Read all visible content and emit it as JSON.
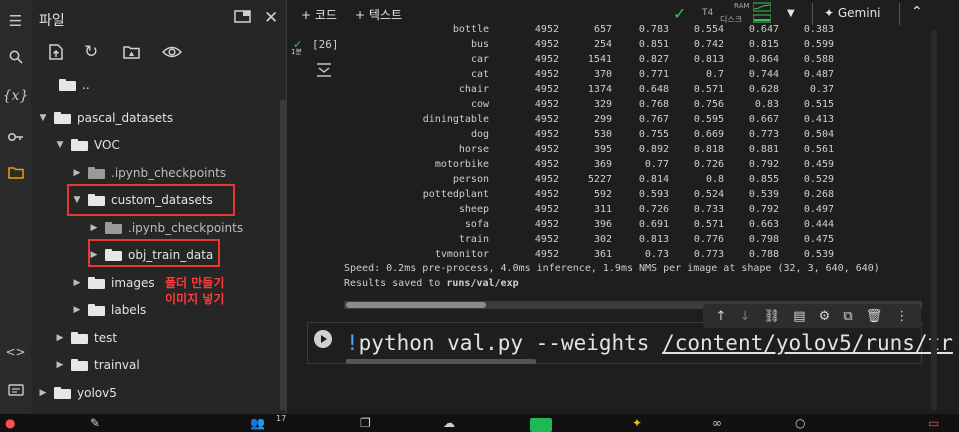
{
  "colors": {
    "accent_red": "#e53935",
    "annotation": "#ff3b3b",
    "run_blue": "#4ea1ff",
    "check_green": "#3ac25a",
    "folder_icon": "orange"
  },
  "rail": {
    "icons": [
      "menu-icon",
      "search-icon",
      "variables-icon",
      "key-icon",
      "folder-icon",
      "code-icon",
      "terminal-icon"
    ],
    "var_label": "{x}"
  },
  "files": {
    "title": "파일",
    "parent_label": "..",
    "tree": [
      {
        "label": "pascal_datasets"
      },
      {
        "label": "VOC"
      },
      {
        "label": ".ipynb_checkpoints"
      },
      {
        "label": "custom_datasets"
      },
      {
        "label": ".ipynb_checkpoints"
      },
      {
        "label": "obj_train_data"
      },
      {
        "label": "images"
      },
      {
        "label": "labels"
      },
      {
        "label": "test"
      },
      {
        "label": "trainval"
      },
      {
        "label": "yolov5"
      }
    ],
    "annotation_line1": "폴더 만들기",
    "annotation_line2": "이미지 넣기"
  },
  "topbar": {
    "add_code": "+ 코드",
    "add_text": "+ 텍스트",
    "gpu": "T4",
    "ram": "RAM",
    "disk": "디스크",
    "gemini": "Gemini"
  },
  "cell": {
    "exec_time": "1분",
    "exec_count": "[26]"
  },
  "results": [
    [
      "bottle",
      "4952",
      "657",
      "0.783",
      "0.554",
      "0.647",
      "0.383"
    ],
    [
      "bus",
      "4952",
      "254",
      "0.851",
      "0.742",
      "0.815",
      "0.599"
    ],
    [
      "car",
      "4952",
      "1541",
      "0.827",
      "0.813",
      "0.864",
      "0.588"
    ],
    [
      "cat",
      "4952",
      "370",
      "0.771",
      "0.7",
      "0.744",
      "0.487"
    ],
    [
      "chair",
      "4952",
      "1374",
      "0.648",
      "0.571",
      "0.628",
      "0.37"
    ],
    [
      "cow",
      "4952",
      "329",
      "0.768",
      "0.756",
      "0.83",
      "0.515"
    ],
    [
      "diningtable",
      "4952",
      "299",
      "0.767",
      "0.595",
      "0.667",
      "0.413"
    ],
    [
      "dog",
      "4952",
      "530",
      "0.755",
      "0.669",
      "0.773",
      "0.504"
    ],
    [
      "horse",
      "4952",
      "395",
      "0.892",
      "0.818",
      "0.881",
      "0.561"
    ],
    [
      "motorbike",
      "4952",
      "369",
      "0.77",
      "0.726",
      "0.792",
      "0.459"
    ],
    [
      "person",
      "4952",
      "5227",
      "0.814",
      "0.8",
      "0.855",
      "0.529"
    ],
    [
      "pottedplant",
      "4952",
      "592",
      "0.593",
      "0.524",
      "0.539",
      "0.268"
    ],
    [
      "sheep",
      "4952",
      "311",
      "0.726",
      "0.733",
      "0.792",
      "0.497"
    ],
    [
      "sofa",
      "4952",
      "396",
      "0.691",
      "0.571",
      "0.663",
      "0.444"
    ],
    [
      "train",
      "4952",
      "302",
      "0.813",
      "0.776",
      "0.798",
      "0.475"
    ],
    [
      "tvmonitor",
      "4952",
      "361",
      "0.73",
      "0.773",
      "0.788",
      "0.539"
    ]
  ],
  "speed_line": "Speed: 0.2ms pre-process, 4.0ms inference, 1.9ms NMS per image at shape (32, 3, 640, 640)",
  "saved_prefix": "Results saved to ",
  "saved_path": "runs/val/exp",
  "code": {
    "bang": "!",
    "cmd": "python val.py --weights ",
    "path": "/content/yolov5/runs/tr"
  },
  "taskbar": {
    "badge_count": "17"
  }
}
